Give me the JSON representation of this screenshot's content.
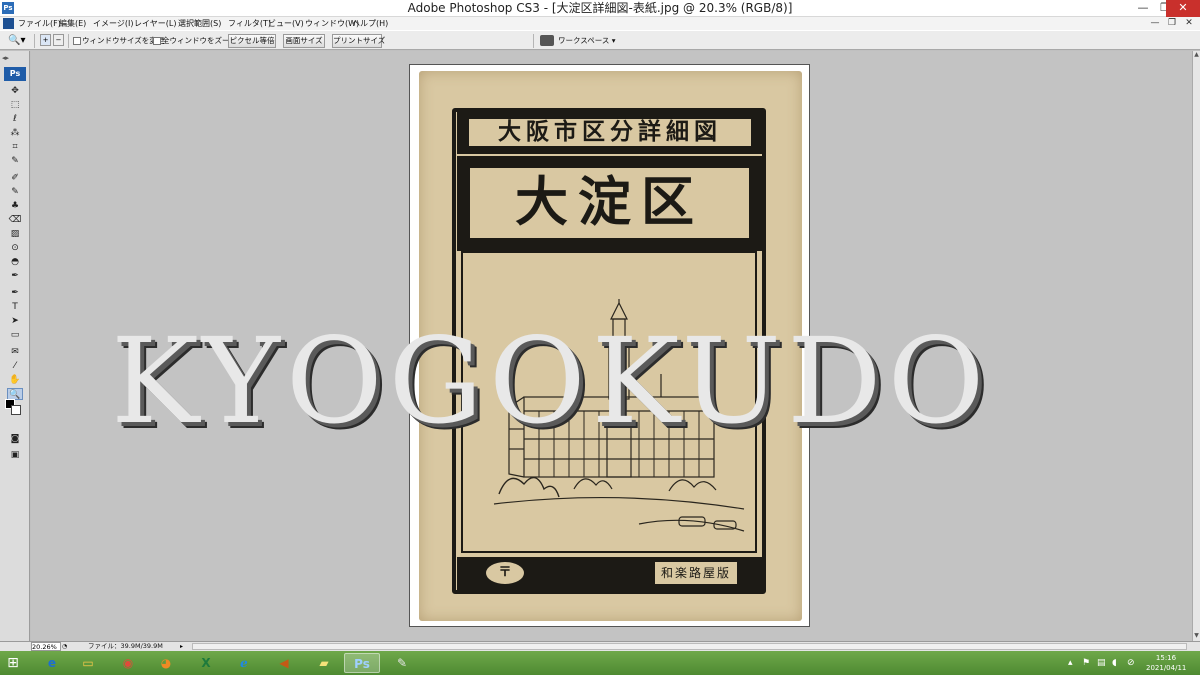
{
  "window": {
    "title": "Adobe Photoshop CS3 - [大淀区詳細図-表紙.jpg @ 20.3% (RGB/8)]",
    "minimize": "—",
    "maximize": "❐",
    "close": "✕"
  },
  "menu": {
    "items": [
      "ファイル(F)",
      "編集(E)",
      "イメージ(I)",
      "レイヤー(L)",
      "選択範囲(S)",
      "フィルタ(T)",
      "ビュー(V)",
      "ウィンドウ(W)",
      "ヘルプ(H)"
    ],
    "doc_min": "—",
    "doc_restore": "❐",
    "doc_close": "✕"
  },
  "options": {
    "checkbox_fit_window": "ウィンドウサイズを変更",
    "checkbox_zoom_all": "全ウィンドウをズーム",
    "btn_actual_pixels": "ピクセル等倍",
    "btn_fit_screen": "画面サイズ",
    "btn_print_size": "プリントサイズ",
    "workspace": "ワークスペース ▾"
  },
  "tools": {
    "ps_label": "Ps",
    "glyphs": [
      "✥",
      "⬚",
      "ℓ",
      "⁂",
      "⌗",
      "✎",
      "✐",
      "✎",
      "♣",
      "⌫",
      "▨",
      "⊙",
      "◓",
      "✒",
      "T",
      "➤",
      "▭",
      "✉",
      "⁄",
      "✋",
      "🔍"
    ]
  },
  "document": {
    "series_title": "大阪市区分詳細図",
    "main_title": "大淀区",
    "publisher": "和楽路屋版",
    "mark": "〒"
  },
  "watermark": "KYOGOKUDO",
  "status": {
    "zoom": "20.26%",
    "file_info": "ファイル：39.9M/39.9M"
  },
  "taskbar": {
    "clock_time": "15:16",
    "clock_date": "2021/04/11"
  }
}
